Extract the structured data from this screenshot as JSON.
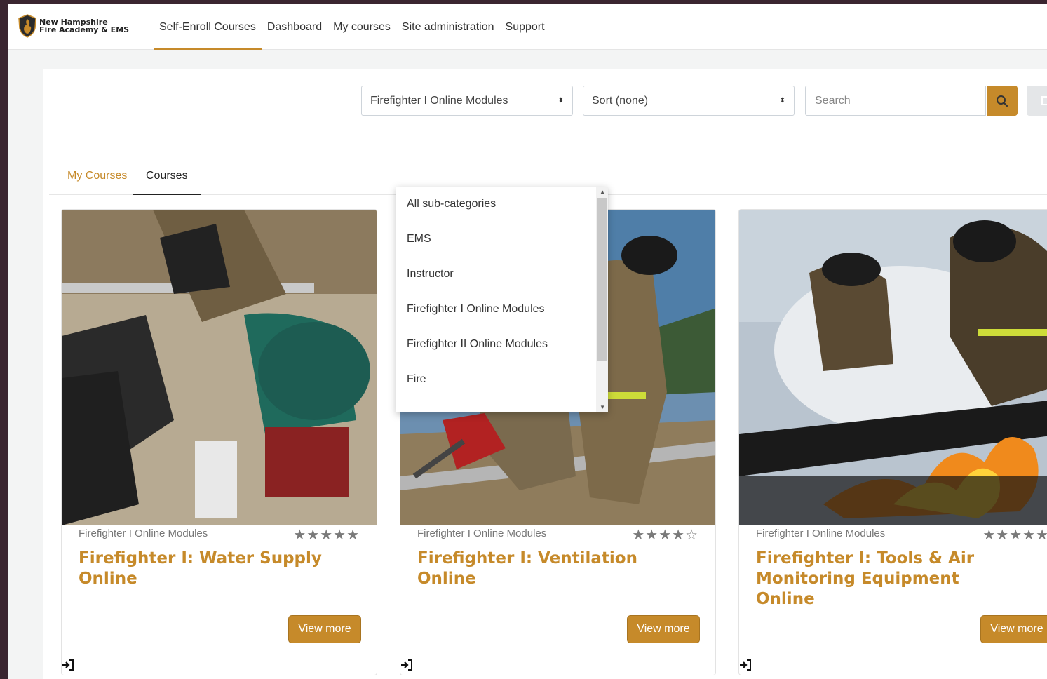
{
  "brand": {
    "name_line1": "New Hampshire",
    "name_line2": "Fire Academy & EMS"
  },
  "nav": [
    {
      "label": "Self-Enroll Courses",
      "active": true
    },
    {
      "label": "Dashboard"
    },
    {
      "label": "My courses"
    },
    {
      "label": "Site administration"
    },
    {
      "label": "Support"
    }
  ],
  "filters": {
    "category_selected": "Firefighter I Online Modules",
    "sort_selected": "Sort (none)",
    "search_placeholder": "Search"
  },
  "dropdown": {
    "options": [
      "All sub-categories",
      "EMS",
      "Instructor",
      "Firefighter I Online Modules",
      "Firefighter II Online Modules",
      "Fire"
    ]
  },
  "tabs": [
    {
      "label": "My Courses"
    },
    {
      "label": "Courses",
      "active": true
    }
  ],
  "courses": [
    {
      "category": "Firefighter I Online Modules",
      "title": "Firefighter I: Water Supply Online",
      "rating": 5,
      "rating_stars": "★★★★★",
      "button": "View more"
    },
    {
      "category": "Firefighter I Online Modules",
      "title": "Firefighter I: Ventilation Online",
      "rating": 4,
      "rating_stars": "★★★★☆",
      "button": "View more"
    },
    {
      "category": "Firefighter I Online Modules",
      "title": "Firefighter I: Tools & Air Monitoring Equipment Online",
      "rating": 5,
      "rating_stars": "★★★★★",
      "button": "View more"
    }
  ],
  "colors": {
    "accent": "#c68a2a"
  },
  "icons": {
    "search": "search-icon",
    "enrol": "enrol-icon",
    "view_toggle": "grid-view-icon"
  }
}
